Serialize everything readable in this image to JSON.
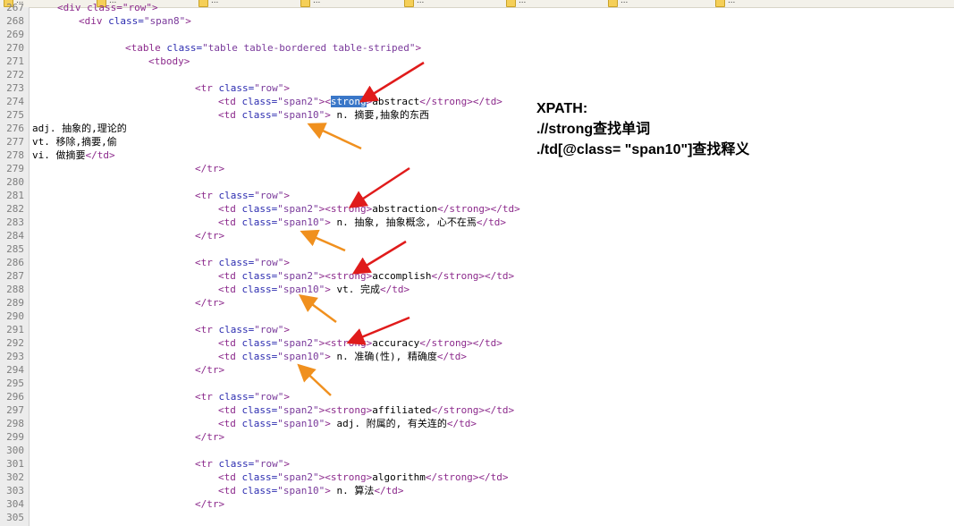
{
  "toolbar": {
    "items": [
      {
        "label": "...",
        "icon": "folder-icon"
      },
      {
        "label": "...",
        "icon": "folder-icon"
      },
      {
        "label": "...",
        "icon": "folder-icon"
      },
      {
        "label": "...",
        "icon": "folder-icon"
      },
      {
        "label": "...",
        "icon": "folder-icon"
      },
      {
        "label": "...",
        "icon": "folder-icon"
      },
      {
        "label": "...",
        "icon": "folder-icon"
      },
      {
        "label": "...",
        "icon": "folder-icon"
      }
    ]
  },
  "editor": {
    "lines": [
      {
        "no": "267",
        "tokens": [
          {
            "t": "<div class=\"row\">",
            "c": "tag"
          }
        ]
      },
      {
        "no": "268",
        "tokens": [
          {
            "t": "<div ",
            "c": "tag"
          },
          {
            "t": "class=",
            "c": "attr"
          },
          {
            "t": "\"span8\"",
            "c": "val"
          },
          {
            "t": ">",
            "c": "tag"
          }
        ]
      },
      {
        "no": "269",
        "tokens": []
      },
      {
        "no": "270",
        "tokens": [
          {
            "t": "<table ",
            "c": "tag"
          },
          {
            "t": "class=",
            "c": "attr"
          },
          {
            "t": "\"table table-bordered table-striped\"",
            "c": "val"
          },
          {
            "t": ">",
            "c": "tag"
          }
        ]
      },
      {
        "no": "271",
        "tokens": [
          {
            "t": "<tbody>",
            "c": "tag"
          }
        ]
      },
      {
        "no": "272",
        "tokens": []
      },
      {
        "no": "273",
        "tokens": [
          {
            "t": "<tr ",
            "c": "tag"
          },
          {
            "t": "class=",
            "c": "attr"
          },
          {
            "t": "\"row\"",
            "c": "val"
          },
          {
            "t": ">",
            "c": "tag"
          }
        ]
      },
      {
        "no": "274",
        "tokens": [
          {
            "t": "<td ",
            "c": "tag"
          },
          {
            "t": "class=",
            "c": "attr"
          },
          {
            "t": "\"span2\"",
            "c": "val"
          },
          {
            "t": "><",
            "c": "tag"
          },
          {
            "t": "strong",
            "c": "hl"
          },
          {
            "t": ">",
            "c": "tag"
          },
          {
            "t": "abstract",
            "c": "text"
          },
          {
            "t": "</strong></td>",
            "c": "tag"
          }
        ]
      },
      {
        "no": "275",
        "tokens": [
          {
            "t": "<td ",
            "c": "tag"
          },
          {
            "t": "class=",
            "c": "attr"
          },
          {
            "t": "\"span10\"",
            "c": "val"
          },
          {
            "t": ">",
            "c": "tag"
          },
          {
            "t": " n. 摘要,抽象的东西",
            "c": "text"
          }
        ]
      },
      {
        "no": "276",
        "tokens": [
          {
            "t": "adj. 抽象的,理论的",
            "c": "text"
          }
        ]
      },
      {
        "no": "277",
        "tokens": [
          {
            "t": "vt. 移除,摘要,偷",
            "c": "text"
          }
        ]
      },
      {
        "no": "278",
        "tokens": [
          {
            "t": "vi. 做摘要",
            "c": "text"
          },
          {
            "t": "</td>",
            "c": "tag"
          }
        ]
      },
      {
        "no": "279",
        "tokens": [
          {
            "t": "</tr>",
            "c": "tag"
          }
        ]
      },
      {
        "no": "280",
        "tokens": []
      },
      {
        "no": "281",
        "tokens": [
          {
            "t": "<tr ",
            "c": "tag"
          },
          {
            "t": "class=",
            "c": "attr"
          },
          {
            "t": "\"row\"",
            "c": "val"
          },
          {
            "t": ">",
            "c": "tag"
          }
        ]
      },
      {
        "no": "282",
        "tokens": [
          {
            "t": "<td ",
            "c": "tag"
          },
          {
            "t": "class=",
            "c": "attr"
          },
          {
            "t": "\"span2\"",
            "c": "val"
          },
          {
            "t": "><strong>",
            "c": "tag"
          },
          {
            "t": "abstraction",
            "c": "text"
          },
          {
            "t": "</strong></td>",
            "c": "tag"
          }
        ]
      },
      {
        "no": "283",
        "tokens": [
          {
            "t": "<td ",
            "c": "tag"
          },
          {
            "t": "class=",
            "c": "attr"
          },
          {
            "t": "\"span10\"",
            "c": "val"
          },
          {
            "t": ">",
            "c": "tag"
          },
          {
            "t": " n. 抽象, 抽象概念, 心不在焉",
            "c": "text"
          },
          {
            "t": "</td>",
            "c": "tag"
          }
        ]
      },
      {
        "no": "284",
        "tokens": [
          {
            "t": "</tr>",
            "c": "tag"
          }
        ]
      },
      {
        "no": "285",
        "tokens": []
      },
      {
        "no": "286",
        "tokens": [
          {
            "t": "<tr ",
            "c": "tag"
          },
          {
            "t": "class=",
            "c": "attr"
          },
          {
            "t": "\"row\"",
            "c": "val"
          },
          {
            "t": ">",
            "c": "tag"
          }
        ]
      },
      {
        "no": "287",
        "tokens": [
          {
            "t": "<td ",
            "c": "tag"
          },
          {
            "t": "class=",
            "c": "attr"
          },
          {
            "t": "\"span2\"",
            "c": "val"
          },
          {
            "t": "><strong>",
            "c": "tag"
          },
          {
            "t": "accomplish",
            "c": "text"
          },
          {
            "t": "</strong></td>",
            "c": "tag"
          }
        ]
      },
      {
        "no": "288",
        "tokens": [
          {
            "t": "<td ",
            "c": "tag"
          },
          {
            "t": "class=",
            "c": "attr"
          },
          {
            "t": "\"span10\"",
            "c": "val"
          },
          {
            "t": ">",
            "c": "tag"
          },
          {
            "t": " vt. 完成",
            "c": "text"
          },
          {
            "t": "</td>",
            "c": "tag"
          }
        ]
      },
      {
        "no": "289",
        "tokens": [
          {
            "t": "</tr>",
            "c": "tag"
          }
        ]
      },
      {
        "no": "290",
        "tokens": []
      },
      {
        "no": "291",
        "tokens": [
          {
            "t": "<tr ",
            "c": "tag"
          },
          {
            "t": "class=",
            "c": "attr"
          },
          {
            "t": "\"row\"",
            "c": "val"
          },
          {
            "t": ">",
            "c": "tag"
          }
        ]
      },
      {
        "no": "292",
        "tokens": [
          {
            "t": "<td ",
            "c": "tag"
          },
          {
            "t": "class=",
            "c": "attr"
          },
          {
            "t": "\"span2\"",
            "c": "val"
          },
          {
            "t": "><strong>",
            "c": "tag"
          },
          {
            "t": "accuracy",
            "c": "text"
          },
          {
            "t": "</strong></td>",
            "c": "tag"
          }
        ]
      },
      {
        "no": "293",
        "tokens": [
          {
            "t": "<td ",
            "c": "tag"
          },
          {
            "t": "class=",
            "c": "attr"
          },
          {
            "t": "\"span10\"",
            "c": "val"
          },
          {
            "t": ">",
            "c": "tag"
          },
          {
            "t": " n. 准确(性), 精确度",
            "c": "text"
          },
          {
            "t": "</td>",
            "c": "tag"
          }
        ]
      },
      {
        "no": "294",
        "tokens": [
          {
            "t": "</tr>",
            "c": "tag"
          }
        ]
      },
      {
        "no": "295",
        "tokens": []
      },
      {
        "no": "296",
        "tokens": [
          {
            "t": "<tr ",
            "c": "tag"
          },
          {
            "t": "class=",
            "c": "attr"
          },
          {
            "t": "\"row\"",
            "c": "val"
          },
          {
            "t": ">",
            "c": "tag"
          }
        ]
      },
      {
        "no": "297",
        "tokens": [
          {
            "t": "<td ",
            "c": "tag"
          },
          {
            "t": "class=",
            "c": "attr"
          },
          {
            "t": "\"span2\"",
            "c": "val"
          },
          {
            "t": "><strong>",
            "c": "tag"
          },
          {
            "t": "affiliated",
            "c": "text"
          },
          {
            "t": "</strong></td>",
            "c": "tag"
          }
        ]
      },
      {
        "no": "298",
        "tokens": [
          {
            "t": "<td ",
            "c": "tag"
          },
          {
            "t": "class=",
            "c": "attr"
          },
          {
            "t": "\"span10\"",
            "c": "val"
          },
          {
            "t": ">",
            "c": "tag"
          },
          {
            "t": " adj. 附属的, 有关连的",
            "c": "text"
          },
          {
            "t": "</td>",
            "c": "tag"
          }
        ]
      },
      {
        "no": "299",
        "tokens": [
          {
            "t": "</tr>",
            "c": "tag"
          }
        ]
      },
      {
        "no": "300",
        "tokens": []
      },
      {
        "no": "301",
        "tokens": [
          {
            "t": "<tr ",
            "c": "tag"
          },
          {
            "t": "class=",
            "c": "attr"
          },
          {
            "t": "\"row\"",
            "c": "val"
          },
          {
            "t": ">",
            "c": "tag"
          }
        ]
      },
      {
        "no": "302",
        "tokens": [
          {
            "t": "<td ",
            "c": "tag"
          },
          {
            "t": "class=",
            "c": "attr"
          },
          {
            "t": "\"span2\"",
            "c": "val"
          },
          {
            "t": "><strong>",
            "c": "tag"
          },
          {
            "t": "algorithm",
            "c": "text"
          },
          {
            "t": "</strong></td>",
            "c": "tag"
          }
        ]
      },
      {
        "no": "303",
        "tokens": [
          {
            "t": "<td ",
            "c": "tag"
          },
          {
            "t": "class=",
            "c": "attr"
          },
          {
            "t": "\"span10\"",
            "c": "val"
          },
          {
            "t": ">",
            "c": "tag"
          },
          {
            "t": " n. 算法",
            "c": "text"
          },
          {
            "t": "</td>",
            "c": "tag"
          }
        ]
      },
      {
        "no": "304",
        "tokens": [
          {
            "t": "</tr>",
            "c": "tag"
          }
        ]
      },
      {
        "no": "305",
        "tokens": []
      }
    ]
  },
  "annotation": {
    "title": "XPATH:",
    "line1": ".//strong查找单词",
    "line2": "./td[@class= \"span10\"]查找释义"
  },
  "colors": {
    "red_arrow": "#e01b1b",
    "orange_arrow": "#f0901e",
    "tag": "#8c2a8c",
    "attr": "#2c2cb0",
    "selection": "#3a77c8"
  }
}
